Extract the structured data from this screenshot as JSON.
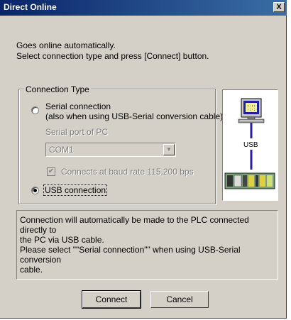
{
  "window": {
    "title": "Direct Online",
    "close_glyph": "X"
  },
  "intro": {
    "line1": "Goes online automatically.",
    "line2": "Select connection type and press [Connect] button."
  },
  "connection_type": {
    "legend": "Connection Type",
    "serial": {
      "label_line1": "Serial connection",
      "label_line2": "(also when using USB-Serial conversion cable)",
      "selected": false
    },
    "serial_port_label": "Serial port of PC",
    "serial_port_value": "COM1",
    "baud_checkbox_label": "Connects at baud rate 115,200 bps",
    "baud_checked": true,
    "usb": {
      "label": "USB connection",
      "selected": true
    }
  },
  "diagram": {
    "usb_label": "USB",
    "monitor_screen_text": "  ::\n ::: ::"
  },
  "info": {
    "line1": "Connection will automatically be made to the PLC connected directly to",
    "line2": "the PC via USB cable.",
    "line3": "Please select \"\"Serial connection\"\" when using USB-Serial conversion",
    "line4": "cable."
  },
  "buttons": {
    "connect": "Connect",
    "cancel": "Cancel"
  },
  "colors": {
    "title_bar": "#0a246a",
    "dialog_face": "#d4d0c8",
    "cable": "#2a1ea8"
  }
}
